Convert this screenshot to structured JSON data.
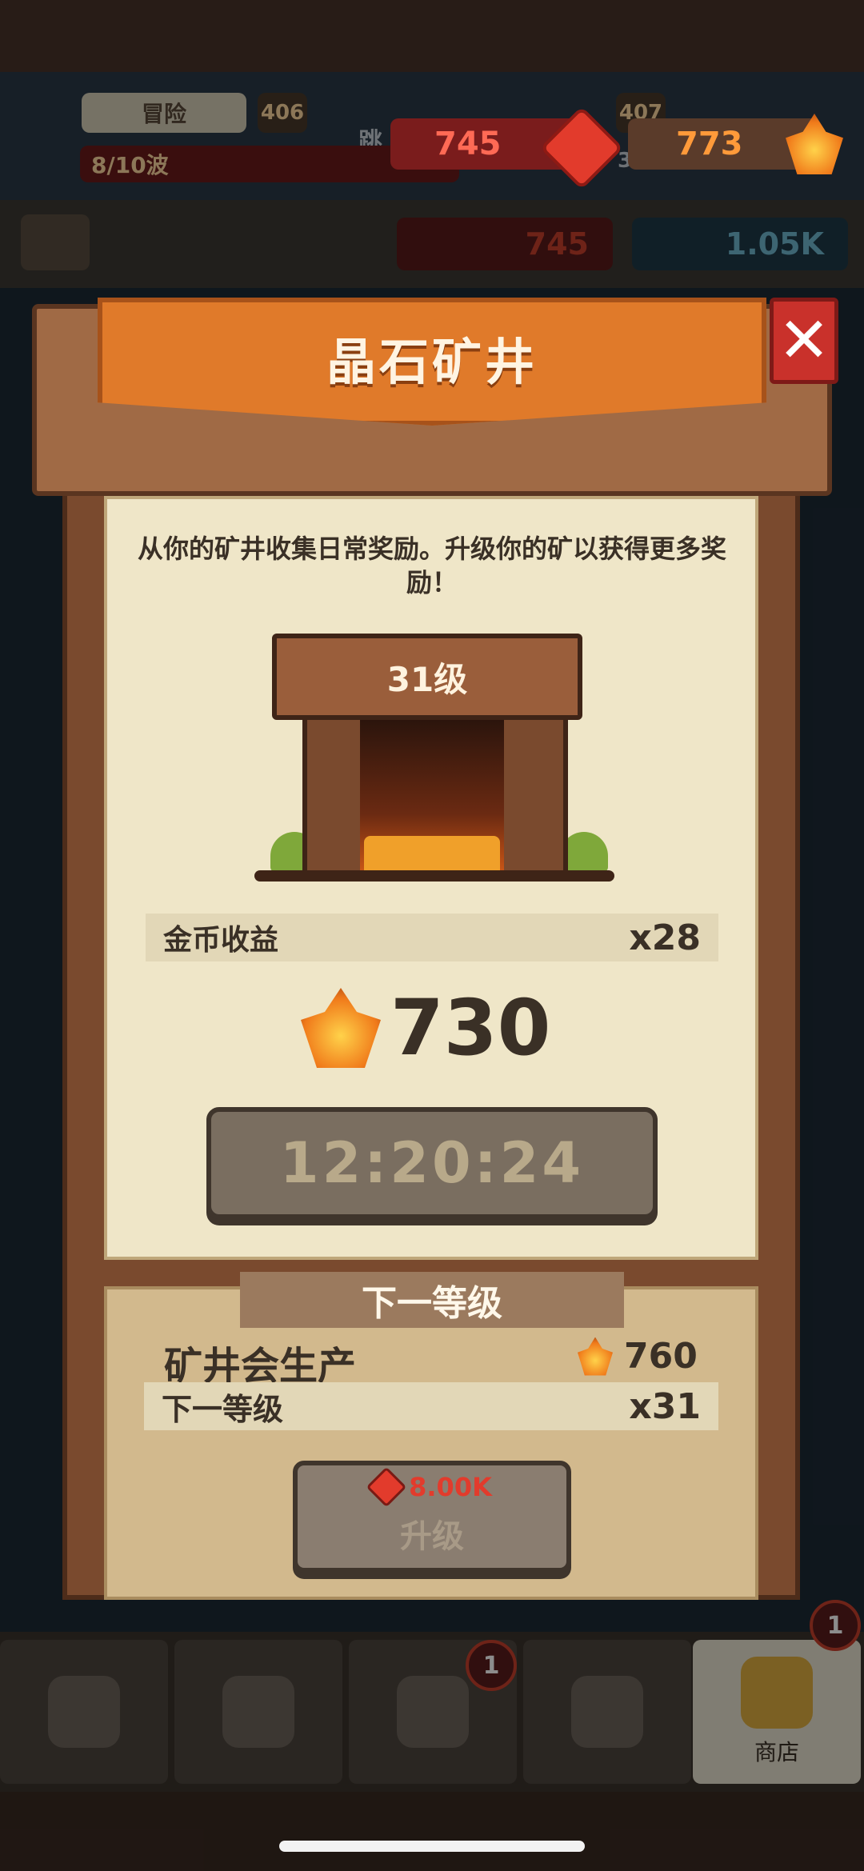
{
  "game_hud": {
    "mode_label": "冒险",
    "level_left": "406",
    "level_right": "407",
    "wave_text": "8/10波",
    "jump_hint": "跳",
    "stat_small": "353",
    "gems_red": "745",
    "crystals": "773",
    "bar_red": "745",
    "bar_blue": "1.05K"
  },
  "dialog": {
    "title": "晶石矿井",
    "close_symbol": "✕",
    "description": "从你的矿井收集日常奖励。升级你的矿以获得更多奖励！",
    "mine_level": "31级",
    "income_label": "金币收益",
    "income_multiplier": "x28",
    "income_amount": "730",
    "timer": "12:20:24",
    "next_level_header": "下一等级",
    "produce_label": "矿井会生产",
    "produce_amount": "760",
    "next_level_label": "下一等级",
    "next_level_multiplier": "x31",
    "upgrade_cost": "8.00K",
    "upgrade_label": "升级"
  },
  "tabbar": {
    "badge_hero": "1",
    "badge_shop": "1",
    "shop_label": "商店"
  }
}
